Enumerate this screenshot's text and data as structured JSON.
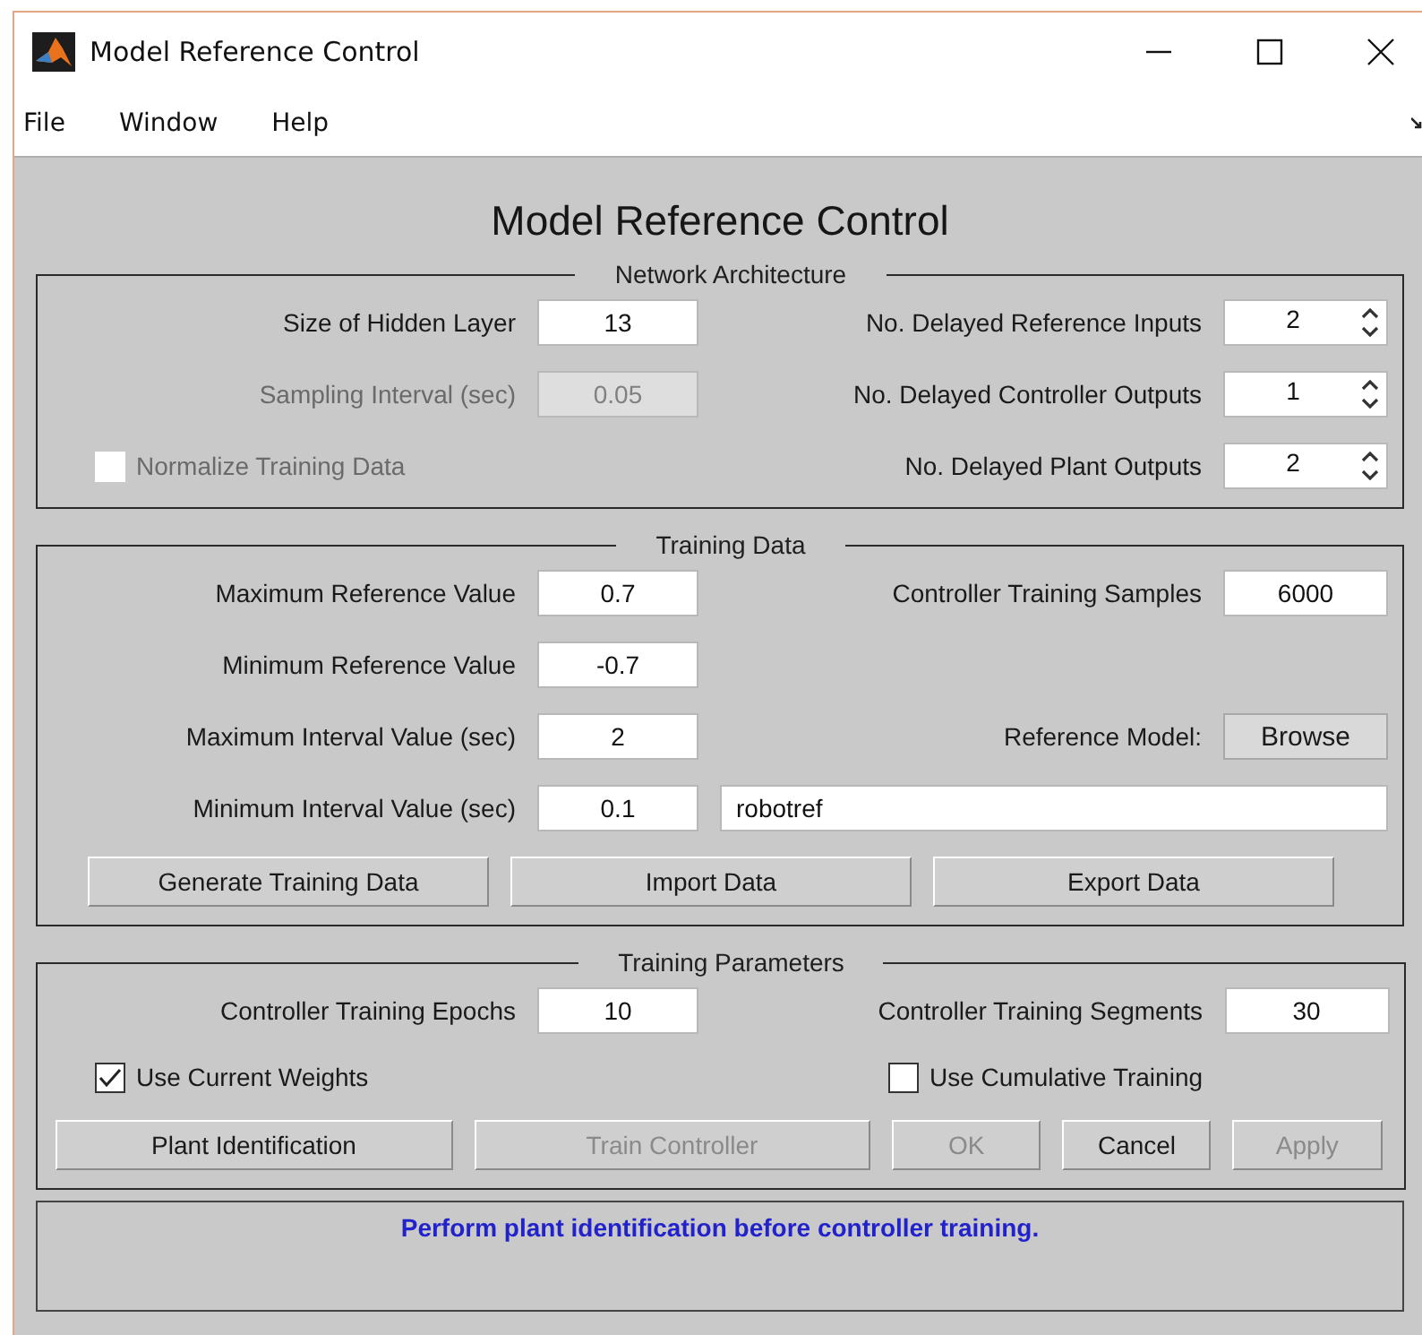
{
  "window": {
    "title": "Model Reference Control"
  },
  "menu": [
    {
      "label": "File"
    },
    {
      "label": "Window"
    },
    {
      "label": "Help"
    }
  ],
  "heading": "Model Reference Control",
  "panels": [
    {
      "title": "Network Architecture",
      "rows": [
        {
          "cells": [
            {
              "kind": "label",
              "text": "Size of Hidden Layer",
              "disabled": false
            },
            {
              "kind": "field",
              "value": "13",
              "disabled": false
            },
            {
              "kind": "label",
              "text": "No. Delayed Reference Inputs",
              "disabled": false
            },
            {
              "kind": "spinner",
              "value": "2",
              "disabled": false
            }
          ]
        },
        {
          "cells": [
            {
              "kind": "label",
              "text": "Sampling Interval (sec)",
              "disabled": true
            },
            {
              "kind": "field",
              "value": "0.05",
              "disabled": true
            },
            {
              "kind": "label",
              "text": "No. Delayed Controller Outputs",
              "disabled": false
            },
            {
              "kind": "spinner",
              "value": "1",
              "disabled": false
            }
          ]
        },
        {
          "cells": [
            {
              "kind": "checkbox",
              "text": "Normalize Training Data",
              "checked": false,
              "disabled": true
            },
            "",
            {
              "kind": "label",
              "text": "No. Delayed Plant Outputs",
              "disabled": false
            },
            {
              "kind": "spinner",
              "value": "2",
              "disabled": false
            }
          ]
        }
      ]
    },
    {
      "title": "Training Data",
      "rows": [
        {
          "cells": [
            {
              "kind": "label",
              "text": "Maximum Reference Value",
              "disabled": false
            },
            {
              "kind": "field",
              "value": "0.7",
              "disabled": false
            },
            {
              "kind": "label",
              "text": "Controller Training Samples",
              "disabled": false
            },
            {
              "kind": "field",
              "value": "6000",
              "disabled": false
            }
          ]
        },
        {
          "cells": [
            {
              "kind": "label",
              "text": "Minimum Reference Value",
              "disabled": false
            },
            {
              "kind": "field",
              "value": "-0.7",
              "disabled": false
            }
          ]
        },
        {
          "cells": [
            {
              "kind": "label",
              "text": "Maximum Interval Value (sec)",
              "disabled": false
            },
            {
              "kind": "field",
              "value": "2",
              "disabled": false
            },
            {
              "kind": "label",
              "text": "Reference Model:",
              "disabled": false
            },
            {
              "kind": "button",
              "text": "Browse",
              "disabled": false
            }
          ]
        },
        {
          "cells": [
            {
              "kind": "label",
              "text": "Minimum Interval Value (sec)",
              "disabled": false
            },
            {
              "kind": "field",
              "value": "0.1",
              "disabled": false
            },
            {
              "kind": "text-field",
              "value": "robotref",
              "disabled": false
            }
          ]
        }
      ],
      "buttons": [
        {
          "text": "Generate Training Data",
          "disabled": false
        },
        {
          "text": "Import Data",
          "disabled": false
        },
        {
          "text": "Export Data",
          "disabled": false
        }
      ]
    },
    {
      "title": "Training Parameters",
      "rows": [
        {
          "cells": [
            {
              "kind": "label",
              "text": "Controller Training Epochs",
              "disabled": false
            },
            {
              "kind": "field",
              "value": "10",
              "disabled": false
            },
            {
              "kind": "label",
              "text": "Controller Training Segments",
              "disabled": false
            },
            {
              "kind": "field",
              "value": "30",
              "disabled": false
            }
          ]
        },
        {
          "cells": [
            {
              "kind": "checkbox",
              "text": "Use Current Weights",
              "checked": true,
              "disabled": false
            },
            "",
            {
              "kind": "checkbox",
              "text": "Use Cumulative Training",
              "checked": false,
              "disabled": false
            }
          ]
        }
      ],
      "buttons": [
        {
          "text": "Plant Identification",
          "disabled": false
        },
        {
          "text": "Train Controller",
          "disabled": true
        },
        {
          "text": "OK",
          "disabled": true
        },
        {
          "text": "Cancel",
          "disabled": false
        },
        {
          "text": "Apply",
          "disabled": true
        }
      ]
    }
  ],
  "status": "Perform plant identification before controller training."
}
